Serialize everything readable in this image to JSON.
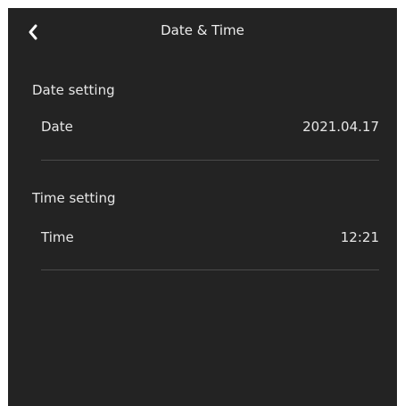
{
  "header": {
    "title": "Date & Time",
    "back_icon": "chevron-left-icon"
  },
  "date_section": {
    "title": "Date setting",
    "row": {
      "label": "Date",
      "value": "2021.04.17"
    }
  },
  "time_section": {
    "title": "Time setting",
    "row": {
      "label": "Time",
      "value": "12:21"
    }
  },
  "colors": {
    "background": "#232323",
    "text": "#e6e6e6",
    "divider": "#4a4a4a"
  }
}
